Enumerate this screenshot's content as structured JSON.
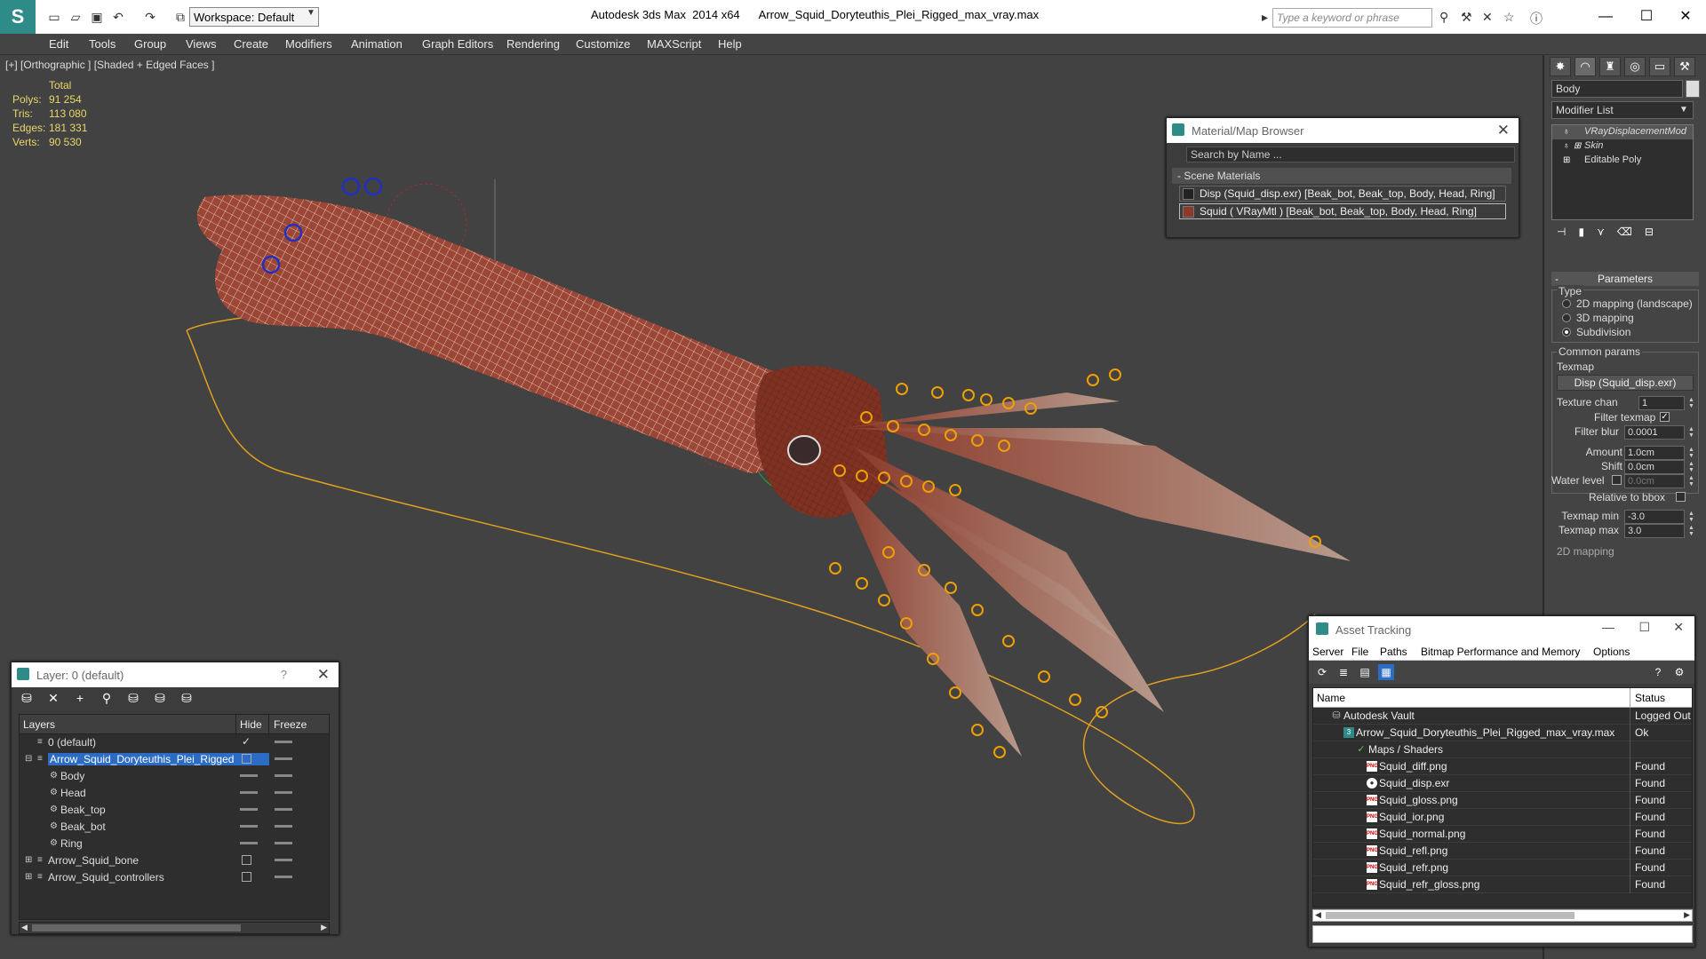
{
  "app": {
    "title": "Autodesk 3ds Max  2014 x64      Arrow_Squid_Doryteuthis_Plei_Rigged_max_vray.max",
    "workspace": "Workspace: Default",
    "search_placeholder": "Type a keyword or phrase"
  },
  "menu": [
    "Edit",
    "Tools",
    "Group",
    "Views",
    "Create",
    "Modifiers",
    "Animation",
    "Graph Editors",
    "Rendering",
    "Customize",
    "MAXScript",
    "Help"
  ],
  "viewport": {
    "label": "[+] [Orthographic ] [Shaded + Edged Faces ]",
    "stats": {
      "total_label": "Total",
      "rows": [
        {
          "k": "Polys:",
          "v": "91 254"
        },
        {
          "k": "Tris:",
          "v": "113 080"
        },
        {
          "k": "Edges:",
          "v": "181 331"
        },
        {
          "k": "Verts:",
          "v": "90 530"
        }
      ]
    }
  },
  "material_browser": {
    "title": "Material/Map Browser",
    "search": "Search by Name ...",
    "section": "- Scene Materials",
    "items": [
      "Disp (Squid_disp.exr) [Beak_bot, Beak_top, Body, Head, Ring]",
      "Squid  ( VRayMtl ) [Beak_bot, Beak_top, Body, Head, Ring]"
    ]
  },
  "command_panel": {
    "object_name": "Body",
    "modifier_list": "Modifier List",
    "stack": [
      "VRayDisplacementMod",
      "Skin",
      "Editable Poly"
    ],
    "parameters_label": "Parameters",
    "type_label": "Type",
    "type_options": [
      "2D mapping (landscape)",
      "3D mapping",
      "Subdivision"
    ],
    "common_params_label": "Common params",
    "texmap_label": "Texmap",
    "texmap_value": "Disp (Squid_disp.exr)",
    "texture_chan_label": "Texture chan",
    "texture_chan_value": "1",
    "filter_texmap_label": "Filter texmap",
    "filter_blur_label": "Filter blur",
    "filter_blur_value": "0.0001",
    "amount_label": "Amount",
    "amount_value": "1.0cm",
    "shift_label": "Shift",
    "shift_value": "0.0cm",
    "water_level_label": "Water level",
    "water_level_value": "0.0cm",
    "relative_bbox_label": "Relative to bbox",
    "texmap_min_label": "Texmap min",
    "texmap_min_value": "-3.0",
    "texmap_max_label": "Texmap max",
    "texmap_max_value": "3.0",
    "mapping_2d_label": "2D mapping"
  },
  "layer_panel": {
    "title": "Layer: 0 (default)",
    "help": "?",
    "col_layers": "Layers",
    "col_hide": "Hide",
    "col_freeze": "Freeze",
    "rows": [
      {
        "name": "0 (default)",
        "level": 0
      },
      {
        "name": "Arrow_Squid_Doryteuthis_Plei_Rigged",
        "level": 0
      },
      {
        "name": "Body",
        "level": 1
      },
      {
        "name": "Head",
        "level": 1
      },
      {
        "name": "Beak_top",
        "level": 1
      },
      {
        "name": "Beak_bot",
        "level": 1
      },
      {
        "name": "Ring",
        "level": 1
      },
      {
        "name": "Arrow_Squid_bone",
        "level": 0
      },
      {
        "name": "Arrow_Squid_controllers",
        "level": 0
      }
    ]
  },
  "asset_tracking": {
    "title": "Asset Tracking",
    "menu": [
      "Server",
      "File",
      "Paths",
      "Bitmap Performance and Memory",
      "Options"
    ],
    "col_name": "Name",
    "col_status": "Status",
    "rows": [
      {
        "name": "Autodesk Vault",
        "status": "Logged Out",
        "icon": "vault"
      },
      {
        "name": "Arrow_Squid_Doryteuthis_Plei_Rigged_max_vray.max",
        "status": "Ok",
        "icon": "max"
      },
      {
        "name": "Maps / Shaders",
        "status": "",
        "icon": "folder"
      },
      {
        "name": "Squid_diff.png",
        "status": "Found",
        "icon": "png"
      },
      {
        "name": "Squid_disp.exr",
        "status": "Found",
        "icon": "exr"
      },
      {
        "name": "Squid_gloss.png",
        "status": "Found",
        "icon": "png"
      },
      {
        "name": "Squid_ior.png",
        "status": "Found",
        "icon": "png"
      },
      {
        "name": "Squid_normal.png",
        "status": "Found",
        "icon": "png"
      },
      {
        "name": "Squid_refl.png",
        "status": "Found",
        "icon": "png"
      },
      {
        "name": "Squid_refr.png",
        "status": "Found",
        "icon": "png"
      },
      {
        "name": "Squid_refr_gloss.png",
        "status": "Found",
        "icon": "png"
      }
    ]
  },
  "colors": {
    "accent": "#2e8b87",
    "selection": "#2c6cc4",
    "stats": "#e8d66a"
  }
}
